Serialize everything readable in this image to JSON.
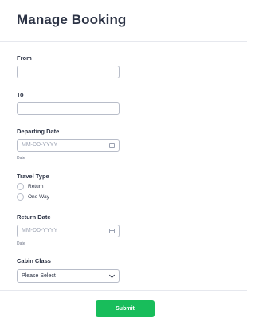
{
  "header": {
    "title": "Manage Booking"
  },
  "form": {
    "from": {
      "label": "From",
      "value": ""
    },
    "to": {
      "label": "To",
      "value": ""
    },
    "departing_date": {
      "label": "Departing Date",
      "placeholder": "MM-DD-YYYY",
      "sublabel": "Date",
      "icon": "calendar-icon"
    },
    "travel_type": {
      "label": "Travel Type",
      "options": [
        "Return",
        "One Way"
      ]
    },
    "return_date": {
      "label": "Return Date",
      "placeholder": "MM-DD-YYYY",
      "sublabel": "Date",
      "icon": "calendar-icon"
    },
    "cabin_class": {
      "label": "Cabin Class",
      "selected": "Please Select"
    }
  },
  "footer": {
    "submit_label": "Submit"
  },
  "colors": {
    "accent": "#18bd5b",
    "text": "#2c3345",
    "border": "#b8bdc9"
  }
}
